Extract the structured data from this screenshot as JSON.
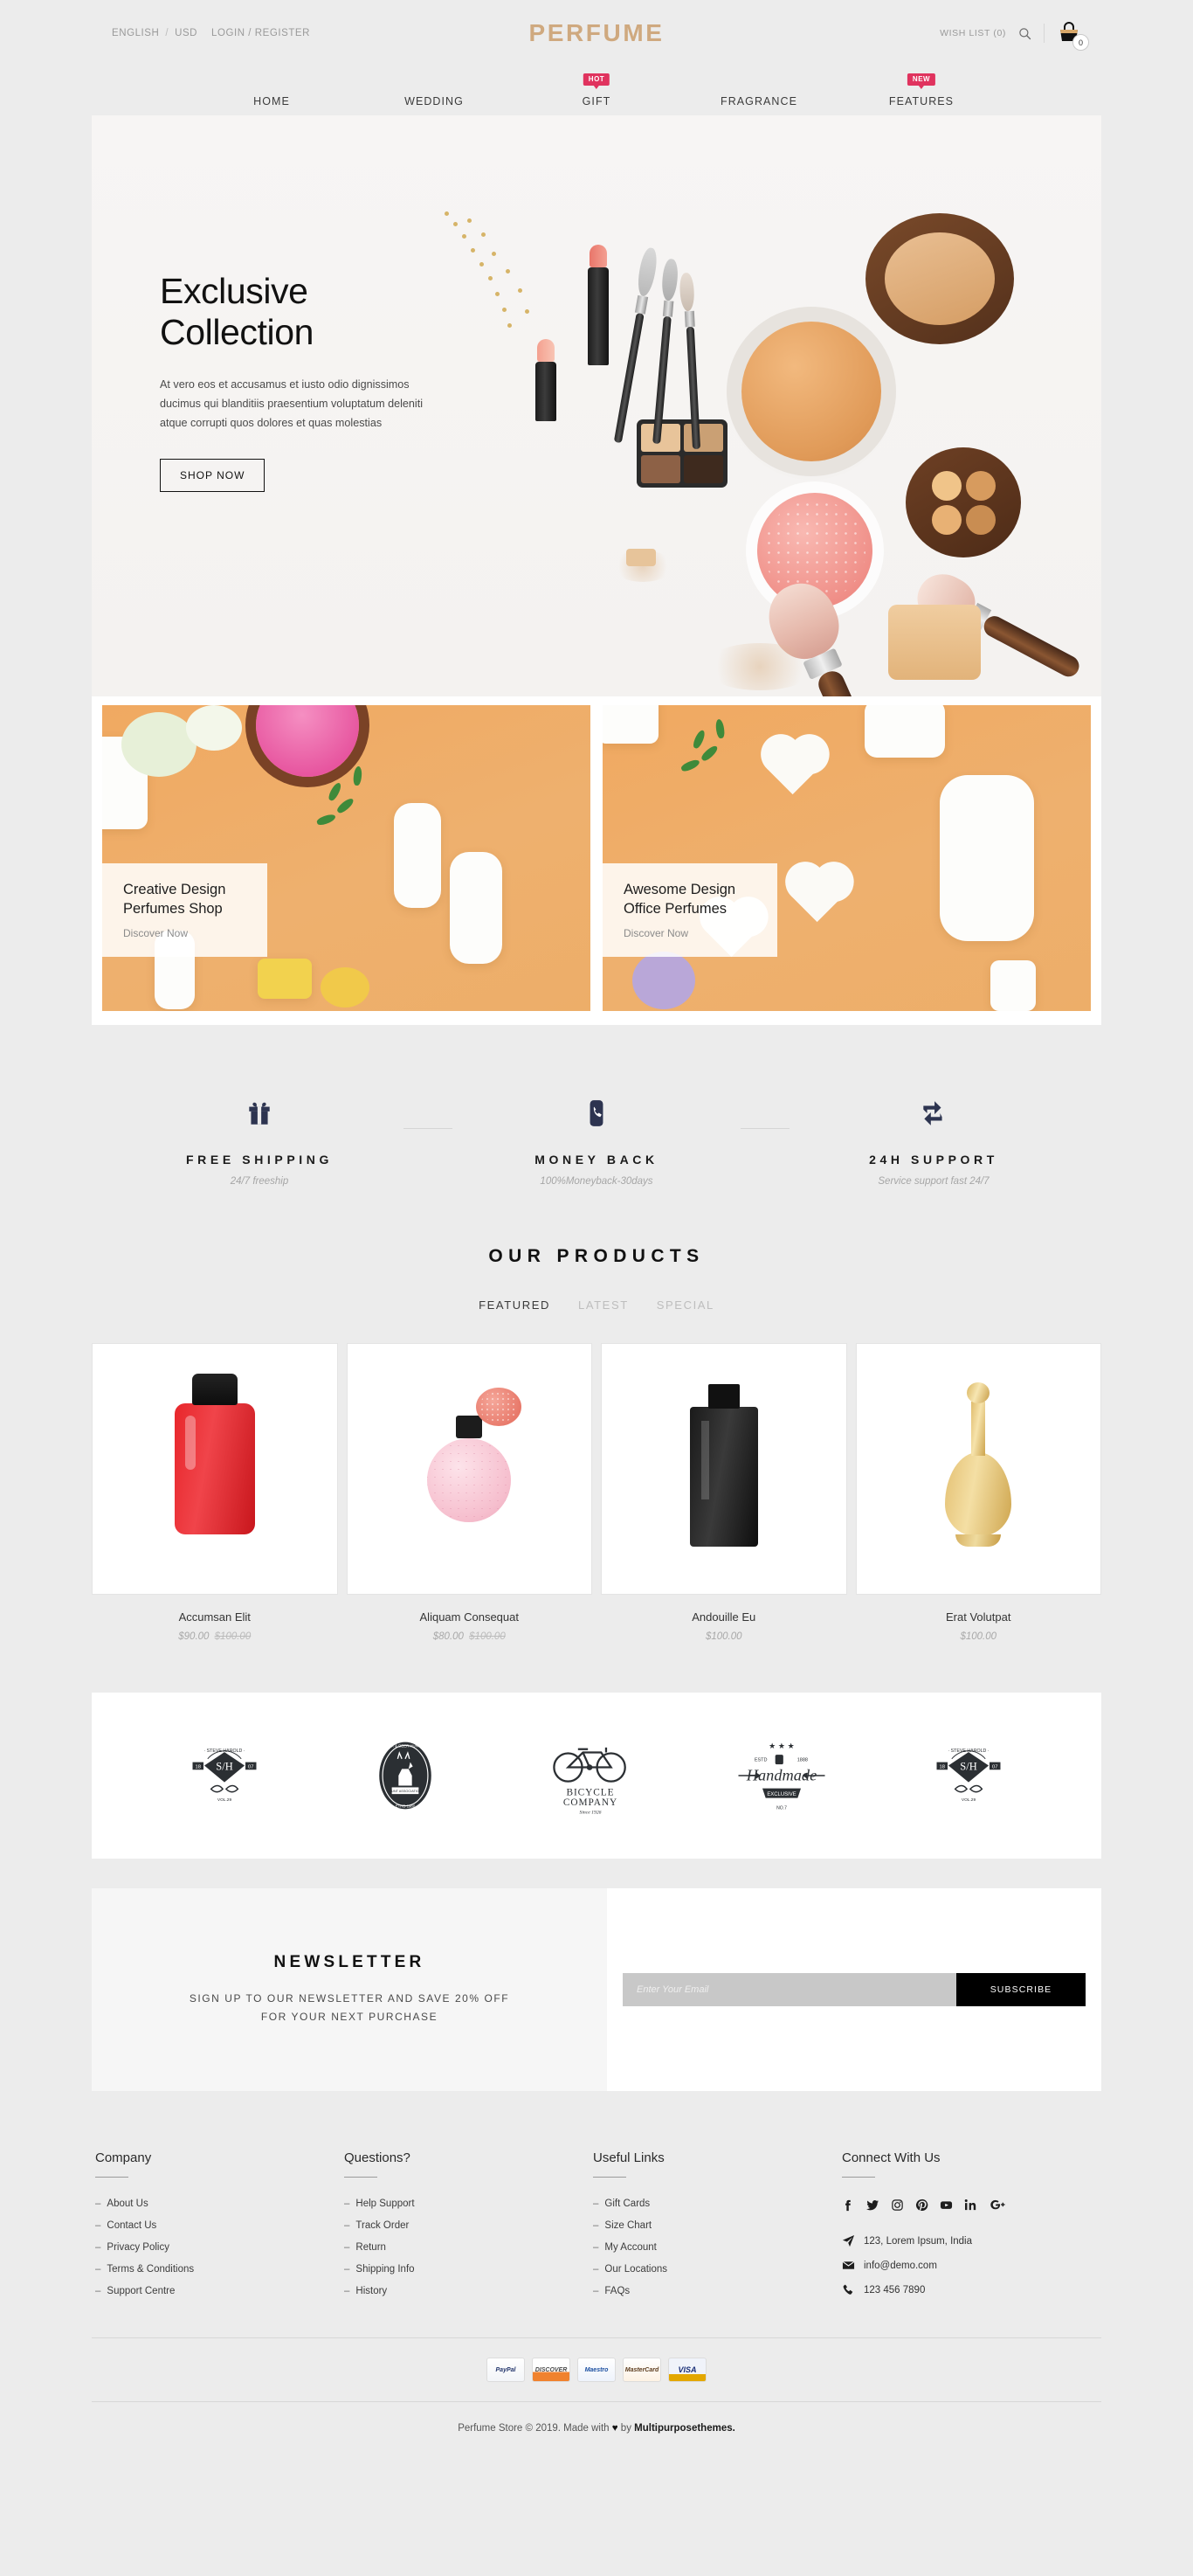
{
  "topbar": {
    "language": "ENGLISH",
    "separator": "/",
    "currency": "USD",
    "login": "LOGIN / REGISTER",
    "brand": "PERFUME",
    "wishlist": "WISH LIST (0)",
    "search_icon": "search-icon",
    "cart_icon": "cart-bag-icon",
    "cart_count": "0"
  },
  "nav": {
    "items": [
      {
        "label": "HOME",
        "badge": ""
      },
      {
        "label": "WEDDING",
        "badge": ""
      },
      {
        "label": "GIFT",
        "badge": "HOT"
      },
      {
        "label": "FRAGRANCE",
        "badge": ""
      },
      {
        "label": "FEATURES",
        "badge": "NEW"
      }
    ],
    "badge_color": "#e0335e"
  },
  "hero": {
    "title": "Exclusive\nCollection",
    "subtitle": "At vero eos et accusamus et iusto odio dignissimos ducimus qui blanditiis praesentium voluptatum deleniti atque corrupti quos dolores et quas molestias",
    "button": "SHOP NOW"
  },
  "promos": [
    {
      "title": "Creative Design\nPerfumes Shop",
      "link": "Discover Now"
    },
    {
      "title": "Awesome Design\nOffice Perfumes",
      "link": "Discover Now"
    }
  ],
  "services": [
    {
      "icon": "gift-icon",
      "title": "FREE SHIPPING",
      "desc": "24/7 freeship"
    },
    {
      "icon": "phone-icon",
      "title": "MONEY BACK",
      "desc": "100%Moneyback-30days"
    },
    {
      "icon": "exchange-icon",
      "title": "24H SUPPORT",
      "desc": "Service support fast 24/7"
    }
  ],
  "products": {
    "section_title": "OUR PRODUCTS",
    "tabs": [
      {
        "label": "FEATURED",
        "active": true
      },
      {
        "label": "LATEST",
        "active": false
      },
      {
        "label": "SPECIAL",
        "active": false
      }
    ],
    "items": [
      {
        "name": "Accumsan Elit",
        "price": "$90.00",
        "old_price": "$100.00",
        "image": "red-perfume-bottle"
      },
      {
        "name": "Aliquam Consequat",
        "price": "$80.00",
        "old_price": "$100.00",
        "image": "pink-atomizer-bottle"
      },
      {
        "name": "Andouille Eu",
        "price": "$100.00",
        "old_price": "",
        "image": "black-perfume-bottle"
      },
      {
        "name": "Erat Volutpat",
        "price": "$100.00",
        "old_price": "",
        "image": "gold-decanter-bottle"
      }
    ]
  },
  "brands": [
    {
      "name": "steve-harold-shield-logo",
      "line1": "STEVE HAROLD",
      "mono": "S/H",
      "left": "18",
      "right": "07",
      "sub": "VOL.29"
    },
    {
      "name": "deer-hunting-oval-logo",
      "line1": "BUCK & DEER HUNTING",
      "sub": "ETHD 1980"
    },
    {
      "name": "bicycle-company-logo",
      "line1": "BICYCLE",
      "line2": "COMPANY",
      "sub": "Since 1926"
    },
    {
      "name": "handmade-exclusive-logo",
      "line1": "Handmade",
      "badge": "EXCLUSIVE",
      "estd": "ESTD 1888",
      "sub": "NO.7"
    },
    {
      "name": "steve-harold-shield-logo-2",
      "line1": "STEVE HAROLD",
      "mono": "S/H",
      "left": "18",
      "right": "07",
      "sub": "VOL.29"
    }
  ],
  "newsletter": {
    "title": "NEWSLETTER",
    "subtitle": "SIGN UP TO OUR NEWSLETTER AND SAVE 20% OFF\nFOR YOUR NEXT PURCHASE",
    "placeholder": "Enter Your Email",
    "value": "",
    "button": "SUBSCRIBE"
  },
  "footer": {
    "columns": [
      {
        "title": "Company",
        "links": [
          "About Us",
          "Contact Us",
          "Privacy Policy",
          "Terms & Conditions",
          "Support Centre"
        ]
      },
      {
        "title": "Questions?",
        "links": [
          "Help Support",
          "Track Order",
          "Return",
          "Shipping Info",
          "History"
        ]
      },
      {
        "title": "Useful Links",
        "links": [
          "Gift Cards",
          "Size Chart",
          "My Account",
          "Our Locations",
          "FAQs"
        ]
      }
    ],
    "connect": {
      "title": "Connect With Us",
      "socials": [
        {
          "name": "facebook-icon",
          "glyph": "f"
        },
        {
          "name": "twitter-icon",
          "glyph": "t"
        },
        {
          "name": "instagram-icon",
          "glyph": "i"
        },
        {
          "name": "pinterest-icon",
          "glyph": "p"
        },
        {
          "name": "youtube-icon",
          "glyph": "y"
        },
        {
          "name": "linkedin-icon",
          "glyph": "in"
        },
        {
          "name": "google-plus-icon",
          "glyph": "G+"
        }
      ],
      "address": "123, Lorem Ipsum, India",
      "email": "info@demo.com",
      "phone": "123 456 7890"
    },
    "payments": [
      {
        "name": "paypal",
        "label": "PayPal"
      },
      {
        "name": "discover",
        "label": "DISCOVER"
      },
      {
        "name": "maestro",
        "label": "Maestro"
      },
      {
        "name": "mastercard",
        "label": "MasterCard"
      },
      {
        "name": "visa",
        "label": "VISA"
      }
    ],
    "copyright_before": "Perfume Store © 2019. Made with ",
    "copyright_heart": "♥",
    "copyright_mid": " by ",
    "copyright_brand": "Multipurposethemes."
  }
}
